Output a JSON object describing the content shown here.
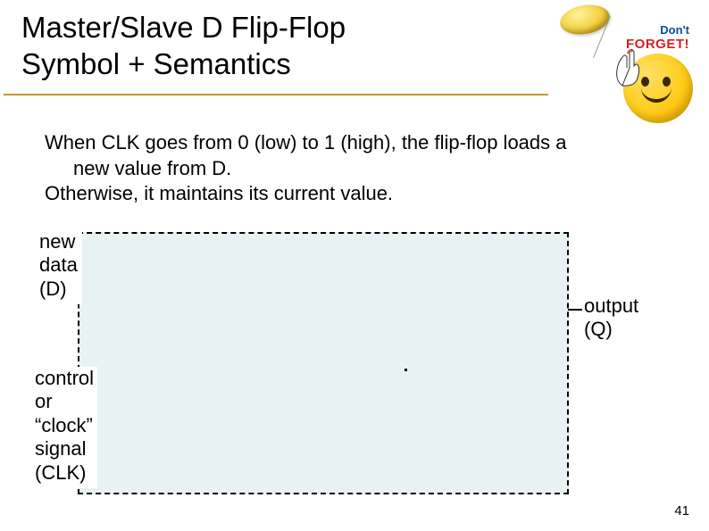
{
  "title_line1": "Master/Slave D Flip-Flop",
  "title_line2": "Symbol + Semantics",
  "body": {
    "sentence1_a": "When CLK goes from 0 (low) to 1 (high), the flip-flop loads a",
    "sentence1_b": "new value from D.",
    "sentence2": "Otherwise, it maintains its current value."
  },
  "labels": {
    "new_data_l1": "new",
    "new_data_l2": "data",
    "new_data_l3": "(D)",
    "output_l1": "output",
    "output_l2": "(Q)",
    "clock_l1": "control",
    "clock_l2": "or",
    "clock_l3": "“clock”",
    "clock_l4": "signal",
    "clock_l5": "(CLK)"
  },
  "sticker": {
    "line1": "Don't",
    "line2": "FORGET!"
  },
  "page_number": "41"
}
